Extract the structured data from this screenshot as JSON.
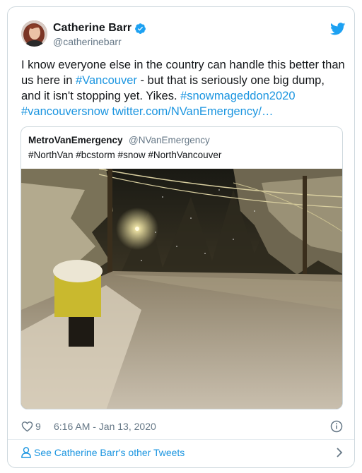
{
  "author": {
    "name": "Catherine Barr",
    "handle": "@catherinebarr"
  },
  "tweet": {
    "text_1": "I know everyone else in the country can handle this better than us here in ",
    "hashtag_vancouver": "#Vancouver",
    "text_2": " - but that is seriously one big dump, and it isn't stopping yet. Yikes. ",
    "hashtag_snowmageddon": "#snowmageddon2020",
    "hashtag_vancouversnow": "#vancouversnow",
    "link": "twitter.com/NVanEmergency/…"
  },
  "quoted": {
    "name": "MetroVanEmergency",
    "handle": "@NVanEmergency",
    "text": "#NorthVan #bcstorm #snow #NorthVancouver"
  },
  "meta": {
    "likes": "9",
    "timestamp": "6:16 AM - Jan 13, 2020"
  },
  "footer": {
    "label": "See Catherine Barr's other Tweets"
  },
  "icons": {
    "logo": "twitter-bird-icon",
    "verified": "verified-badge-icon",
    "like": "heart-icon",
    "info": "info-icon",
    "profile": "person-icon",
    "more": "chevron-right-icon"
  },
  "colors": {
    "link": "#1b95e0",
    "secondary": "#657786",
    "border": "#cfd9de"
  }
}
